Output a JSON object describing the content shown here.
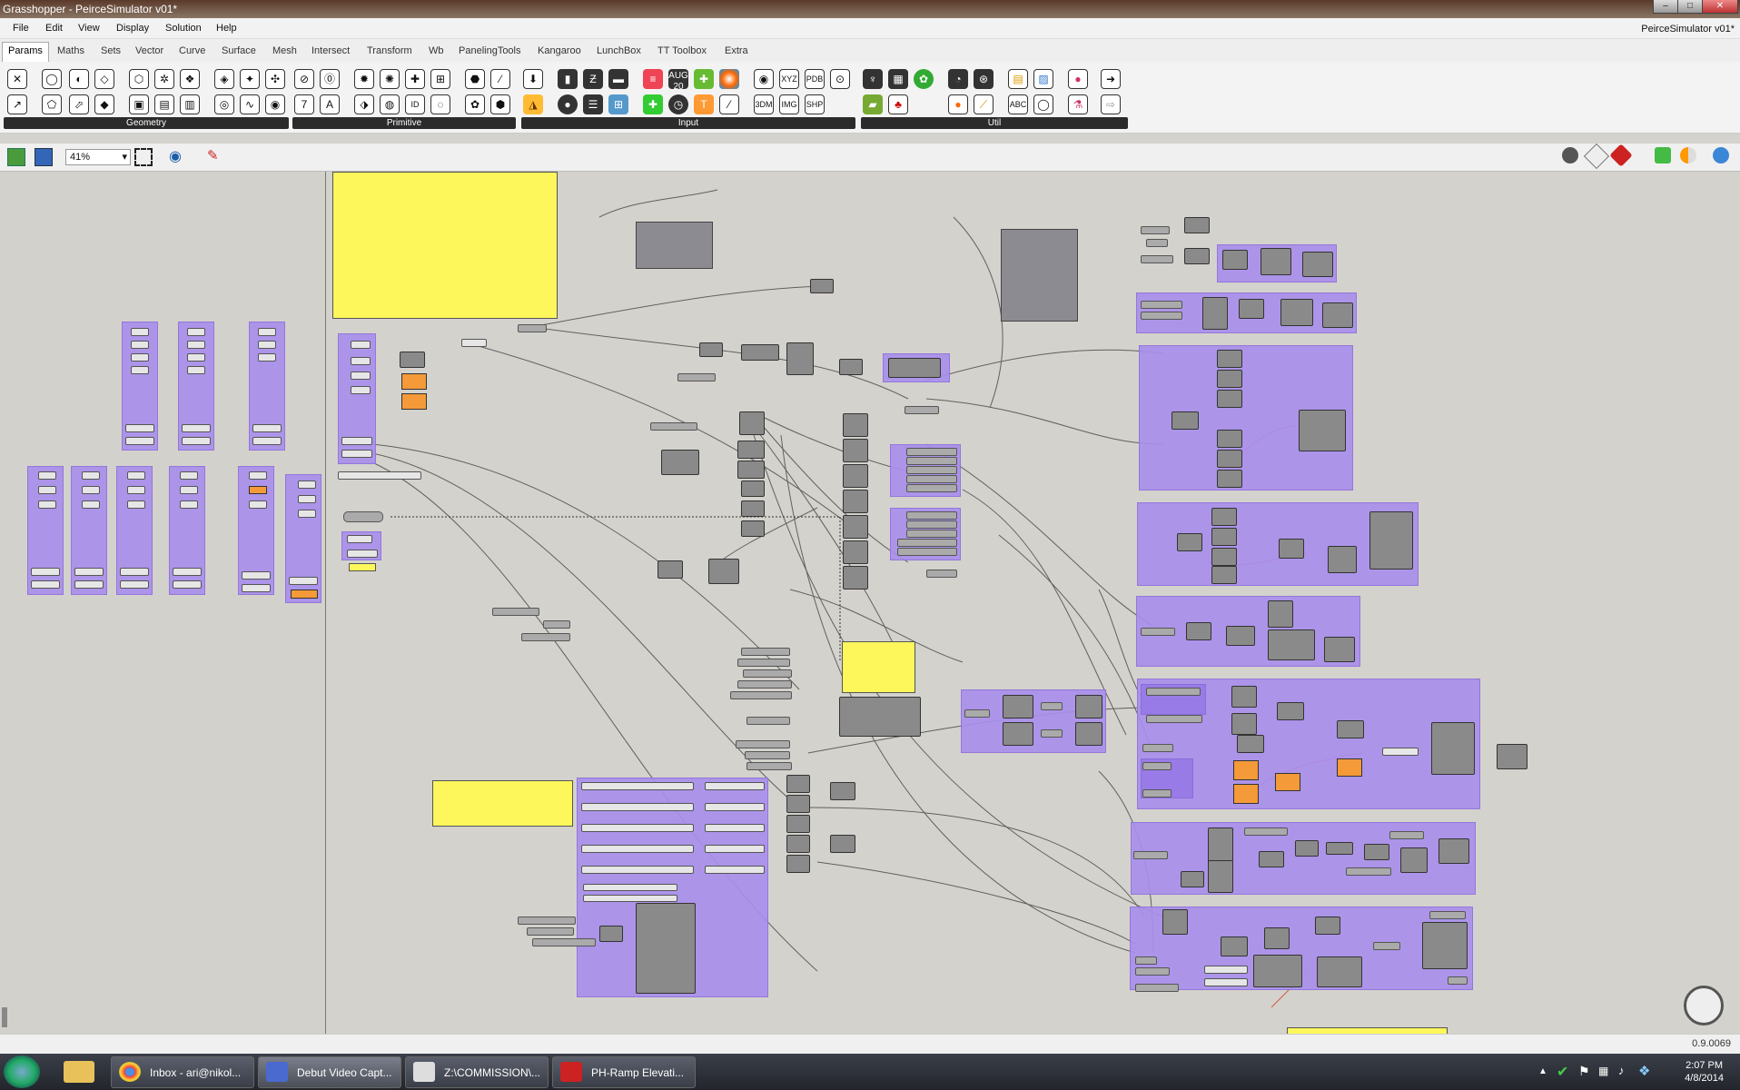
{
  "window": {
    "title": "Grasshopper - PeirceSimulator v01*",
    "doc_title": "PeirceSimulator v01*"
  },
  "menu": [
    "File",
    "Edit",
    "View",
    "Display",
    "Solution",
    "Help"
  ],
  "tabs": [
    "Params",
    "Maths",
    "Sets",
    "Vector",
    "Curve",
    "Surface",
    "Mesh",
    "Intersect",
    "Transform",
    "Wb",
    "PanelingTools",
    "Kangaroo",
    "LunchBox",
    "TT Toolbox",
    "Extra"
  ],
  "active_tab": "Params",
  "toolbar_groups": [
    {
      "label": "Geometry"
    },
    {
      "label": "Primitive"
    },
    {
      "label": "Input"
    },
    {
      "label": "Util"
    }
  ],
  "toolbar_text_icons": {
    "aug": "AUG",
    "twenty": "20",
    "xyz": "XYZ",
    "pdb": "PDB",
    "threedm": "3DM",
    "img": "IMG",
    "shp": "SHP",
    "abc": "ABC",
    "seven": "7",
    "a": "A",
    "id": "ID"
  },
  "canvas_toolbar": {
    "zoom": "41%"
  },
  "status": {
    "version": "0.9.0069"
  },
  "taskbar": {
    "items": [
      {
        "label": "Inbox - ari@nikol..."
      },
      {
        "label": "Debut Video Capt..."
      },
      {
        "label": "Z:\\COMMISSION\\..."
      },
      {
        "label": "PH-Ramp Elevati..."
      }
    ],
    "clock_time": "2:07 PM",
    "clock_date": "4/8/2014"
  },
  "colors": {
    "group": "#a88eec",
    "note": "#fdf75b",
    "orange": "#f49a38",
    "canvas": "#d4d2cc"
  }
}
